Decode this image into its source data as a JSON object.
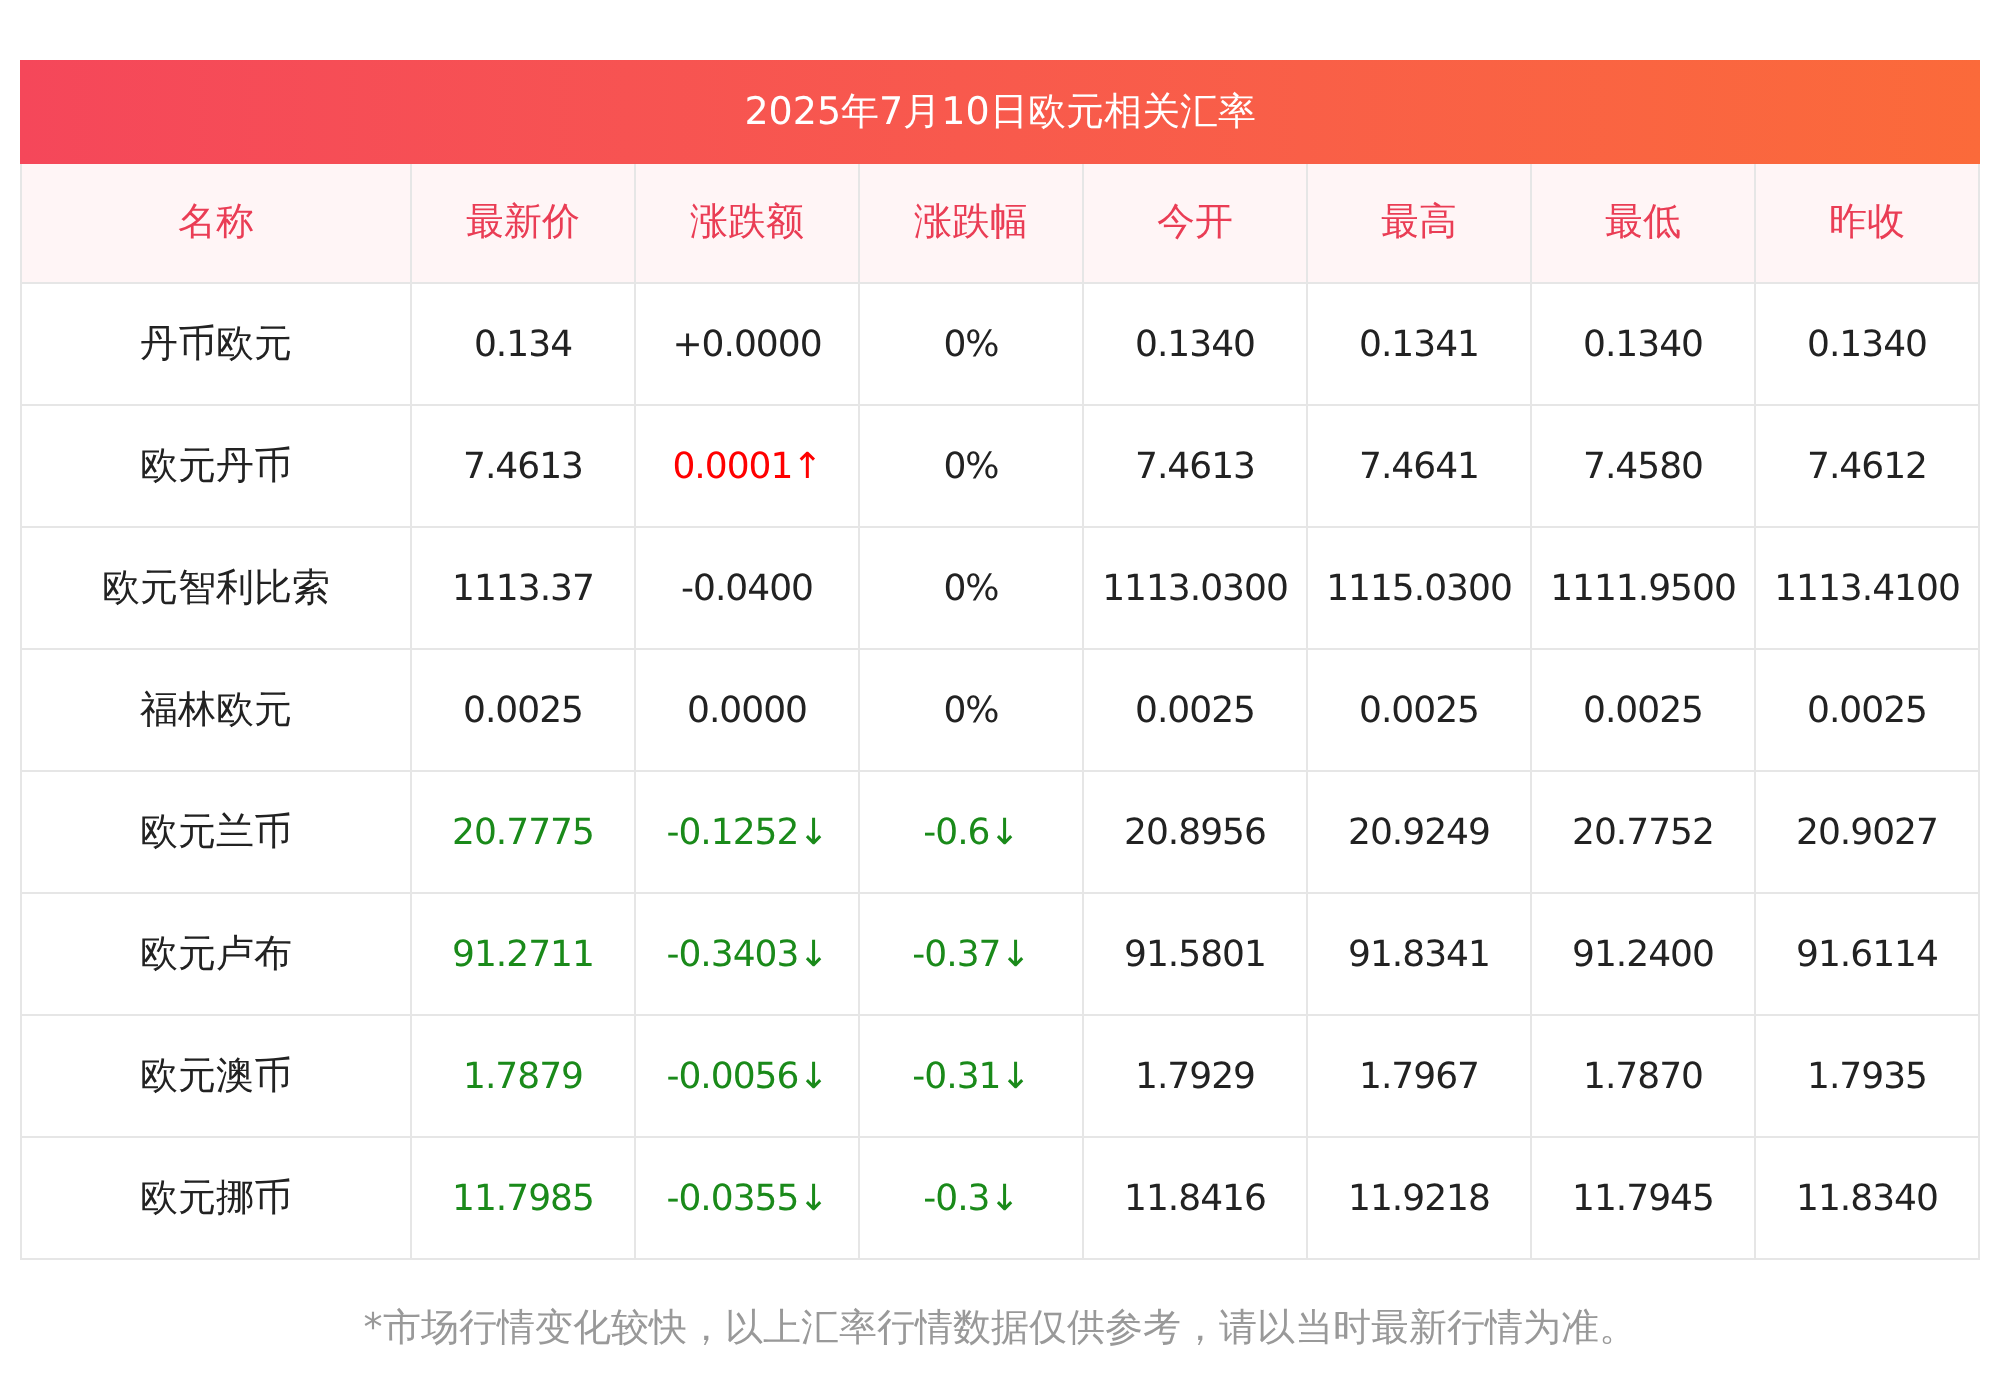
{
  "title": "2025年7月10日欧元相关汇率",
  "columns": [
    "名称",
    "最新价",
    "涨跌额",
    "涨跌幅",
    "今开",
    "最高",
    "最低",
    "昨收"
  ],
  "rows": [
    {
      "name": "丹币欧元",
      "values": [
        {
          "text": "0.134",
          "color": "#222222"
        },
        {
          "text": "+0.0000",
          "color": "#222222"
        },
        {
          "text": "0%",
          "color": "#222222"
        },
        {
          "text": "0.1340",
          "color": "#222222"
        },
        {
          "text": "0.1341",
          "color": "#222222"
        },
        {
          "text": "0.1340",
          "color": "#222222"
        },
        {
          "text": "0.1340",
          "color": "#222222"
        }
      ]
    },
    {
      "name": "欧元丹币",
      "values": [
        {
          "text": "7.4613",
          "color": "#222222"
        },
        {
          "text": "0.0001↑",
          "color": "#ff0000"
        },
        {
          "text": "0%",
          "color": "#222222"
        },
        {
          "text": "7.4613",
          "color": "#222222"
        },
        {
          "text": "7.4641",
          "color": "#222222"
        },
        {
          "text": "7.4580",
          "color": "#222222"
        },
        {
          "text": "7.4612",
          "color": "#222222"
        }
      ]
    },
    {
      "name": "欧元智利比索",
      "values": [
        {
          "text": "1113.37",
          "color": "#222222"
        },
        {
          "text": "-0.0400",
          "color": "#222222"
        },
        {
          "text": "0%",
          "color": "#222222"
        },
        {
          "text": "1113.0300",
          "color": "#222222"
        },
        {
          "text": "1115.0300",
          "color": "#222222"
        },
        {
          "text": "1111.9500",
          "color": "#222222"
        },
        {
          "text": "1113.4100",
          "color": "#222222"
        }
      ]
    },
    {
      "name": "福林欧元",
      "values": [
        {
          "text": "0.0025",
          "color": "#222222"
        },
        {
          "text": "0.0000",
          "color": "#222222"
        },
        {
          "text": "0%",
          "color": "#222222"
        },
        {
          "text": "0.0025",
          "color": "#222222"
        },
        {
          "text": "0.0025",
          "color": "#222222"
        },
        {
          "text": "0.0025",
          "color": "#222222"
        },
        {
          "text": "0.0025",
          "color": "#222222"
        }
      ]
    },
    {
      "name": "欧元兰币",
      "values": [
        {
          "text": "20.7775",
          "color": "#1a8a1a"
        },
        {
          "text": "-0.1252↓",
          "color": "#1a8a1a"
        },
        {
          "text": "-0.6↓",
          "color": "#1a8a1a"
        },
        {
          "text": "20.8956",
          "color": "#222222"
        },
        {
          "text": "20.9249",
          "color": "#222222"
        },
        {
          "text": "20.7752",
          "color": "#222222"
        },
        {
          "text": "20.9027",
          "color": "#222222"
        }
      ]
    },
    {
      "name": "欧元卢布",
      "values": [
        {
          "text": "91.2711",
          "color": "#1a8a1a"
        },
        {
          "text": "-0.3403↓",
          "color": "#1a8a1a"
        },
        {
          "text": "-0.37↓",
          "color": "#1a8a1a"
        },
        {
          "text": "91.5801",
          "color": "#222222"
        },
        {
          "text": "91.8341",
          "color": "#222222"
        },
        {
          "text": "91.2400",
          "color": "#222222"
        },
        {
          "text": "91.6114",
          "color": "#222222"
        }
      ]
    },
    {
      "name": "欧元澳币",
      "values": [
        {
          "text": "1.7879",
          "color": "#1a8a1a"
        },
        {
          "text": "-0.0056↓",
          "color": "#1a8a1a"
        },
        {
          "text": "-0.31↓",
          "color": "#1a8a1a"
        },
        {
          "text": "1.7929",
          "color": "#222222"
        },
        {
          "text": "1.7967",
          "color": "#222222"
        },
        {
          "text": "1.7870",
          "color": "#222222"
        },
        {
          "text": "1.7935",
          "color": "#222222"
        }
      ]
    },
    {
      "name": "欧元挪币",
      "values": [
        {
          "text": "11.7985",
          "color": "#1a8a1a"
        },
        {
          "text": "-0.0355↓",
          "color": "#1a8a1a"
        },
        {
          "text": "-0.3↓",
          "color": "#1a8a1a"
        },
        {
          "text": "11.8416",
          "color": "#222222"
        },
        {
          "text": "11.9218",
          "color": "#222222"
        },
        {
          "text": "11.7945",
          "color": "#222222"
        },
        {
          "text": "11.8340",
          "color": "#222222"
        }
      ]
    }
  ],
  "footnote": "*市场行情变化较快，以上汇率行情数据仅供参考，请以当时最新行情为准。"
}
